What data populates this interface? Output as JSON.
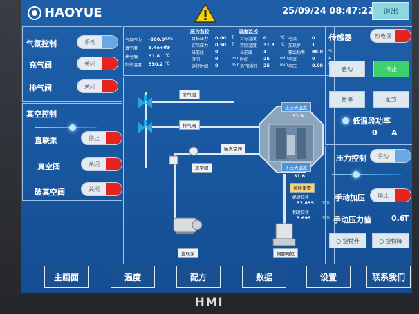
{
  "header": {
    "brand": "HAOYUE",
    "datetime": "25/09/24 08:47:22",
    "exit_label": "退出"
  },
  "colors": {
    "screen": "#1f5fa8",
    "on": "#e52420",
    "accent": "#6aa8e4",
    "go": "#3ed06a"
  },
  "left": {
    "atmos_label": "气氛控制",
    "atmos_toggle": "手动",
    "fill_valve_label": "充气阀",
    "fill_valve_toggle": "关闭",
    "exhaust_valve_label": "排气阀",
    "exhaust_valve_toggle": "关闭",
    "vacuum_title": "真空控制",
    "direct_pump_label": "直联泵",
    "direct_pump_toggle": "停止",
    "vacuum_valve_label": "真空阀",
    "vacuum_valve_toggle": "关闭",
    "break_valve_label": "破真空阀",
    "break_valve_toggle": "关闭"
  },
  "grid": {
    "col1": [
      {
        "k": "气氛压力",
        "v": "-100.0",
        "u": "KPa"
      },
      {
        "k": "真空度",
        "v": "9.4e+01",
        "u": "Pa"
      },
      {
        "k": "热电偶",
        "v": "31.8",
        "u": "℃"
      },
      {
        "k": "红外温度",
        "v": "550.2",
        "u": "℃"
      }
    ],
    "pressure_title": "压力监控",
    "col2": [
      {
        "k": "目标压力",
        "v": "0.00",
        "u": "T"
      },
      {
        "k": "实际压力",
        "v": "0.50",
        "u": "T"
      },
      {
        "k": "当前段",
        "v": "0",
        "u": ""
      },
      {
        "k": "时间",
        "v": "0",
        "u": "min"
      },
      {
        "k": "运行时间",
        "v": "0",
        "u": "min"
      }
    ],
    "temp_title": "温度监控",
    "col3": [
      {
        "k": "目标温度",
        "v": "0",
        "u": "℃"
      },
      {
        "k": "实际温度",
        "v": "31.8",
        "u": "℃"
      },
      {
        "k": "当前段",
        "v": "1",
        "u": ""
      },
      {
        "k": "时间",
        "v": "25",
        "u": "min"
      },
      {
        "k": "运行时间",
        "v": "25",
        "u": "min"
      }
    ],
    "col4": [
      {
        "k": "电流",
        "v": "0",
        "u": "A"
      },
      {
        "k": "加热步",
        "v": "1",
        "u": ""
      },
      {
        "k": "输出功率",
        "v": "98.0",
        "u": "%"
      },
      {
        "k": "电流",
        "v": "0",
        "u": "A"
      },
      {
        "k": "电压",
        "v": "0.00",
        "u": "V"
      }
    ]
  },
  "diagram": {
    "fill_valve": "充气阀",
    "exhaust_valve": "排气阀",
    "break_valve": "破真空阀",
    "vacuum_valve": "真空阀",
    "upper_head": "上压头温度",
    "upper_value": "31.8",
    "lower_head": "下压头温度",
    "lower_value": "31.6",
    "disp_title": "位移重零",
    "abs_label": "绝对位移",
    "abs_value": "57.855",
    "abs_unit": "mm",
    "rel_label": "相对位移",
    "rel_value": "5.695",
    "rel_unit": "mm",
    "pump": "直联泵",
    "servo": "伺服电缸"
  },
  "right": {
    "sensor_label": "传感器",
    "sensor_toggle": "热电偶",
    "start": "启动",
    "stop": "停止",
    "pause": "暂停",
    "recipe": "配方",
    "low_temp_label": "低温段功率",
    "low_temp_value": "0",
    "low_temp_unit": "A",
    "pressure_ctrl": "压力控制",
    "pressure_toggle": "手动",
    "manual_press": "手动加压",
    "manual_press_toggle": "停止",
    "manual_value_label": "手动压力值",
    "manual_value": "0.6",
    "manual_unit": "T",
    "empty_up": "空特升",
    "empty_down": "空特降"
  },
  "nav": [
    "主画面",
    "温度",
    "配方",
    "数据",
    "设置",
    "联系我们"
  ],
  "device_label": "HMI"
}
